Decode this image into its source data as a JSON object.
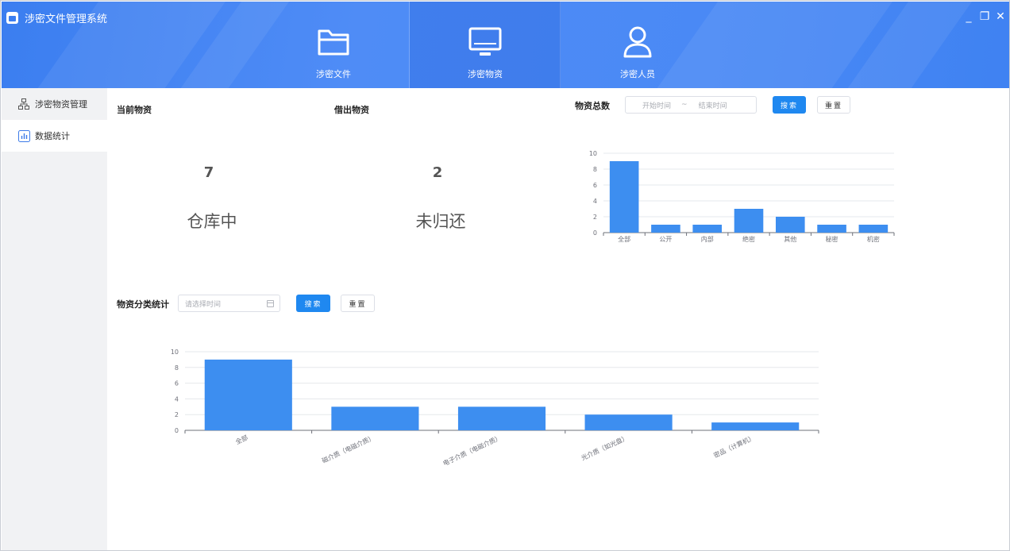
{
  "app": {
    "title": "涉密文件管理系统"
  },
  "nav": [
    {
      "label": "涉密文件",
      "icon": "folder-icon"
    },
    {
      "label": "涉密物资",
      "icon": "monitor-icon"
    },
    {
      "label": "涉密人员",
      "icon": "user-icon"
    }
  ],
  "window_controls": {
    "minimize": "_",
    "restore": "❐",
    "close": "✕"
  },
  "sidebar": [
    {
      "label": "涉密物资管理",
      "icon": "hierarchy-icon"
    },
    {
      "label": "数据统计",
      "icon": "bar-chart-icon"
    }
  ],
  "summary": {
    "current": {
      "title": "当前物资",
      "value": "7",
      "label": "仓库中"
    },
    "borrowed": {
      "title": "借出物资",
      "value": "2",
      "label": "未归还"
    }
  },
  "total_panel": {
    "title": "物资总数",
    "start_placeholder": "开始时间",
    "separator": "~",
    "end_placeholder": "结束时间",
    "search_label": "搜索",
    "reset_label": "重置"
  },
  "category_panel": {
    "title": "物资分类统计",
    "date_placeholder": "请选择时间",
    "search_label": "搜索",
    "reset_label": "重置"
  },
  "colors": {
    "accent": "#1f88f0",
    "bar": "#3d8ef0",
    "header": "#4a89f5"
  },
  "chart_data": [
    {
      "type": "bar",
      "categories": [
        "全部",
        "公开",
        "内部",
        "绝密",
        "其他",
        "秘密",
        "机密"
      ],
      "values": [
        9,
        1,
        1,
        3,
        2,
        1,
        1
      ],
      "ylim": [
        0,
        10
      ],
      "yticks": [
        0,
        2,
        4,
        6,
        8,
        10
      ],
      "grid": true
    },
    {
      "type": "bar",
      "categories": [
        "全部",
        "磁介质（电磁介质）",
        "电子介质（电磁介质）",
        "光介质（如光盘）",
        "密品（计算机）"
      ],
      "values": [
        9,
        3,
        3,
        2,
        1
      ],
      "ylim": [
        0,
        10
      ],
      "yticks": [
        0,
        2,
        4,
        6,
        8,
        10
      ],
      "grid": true
    }
  ]
}
